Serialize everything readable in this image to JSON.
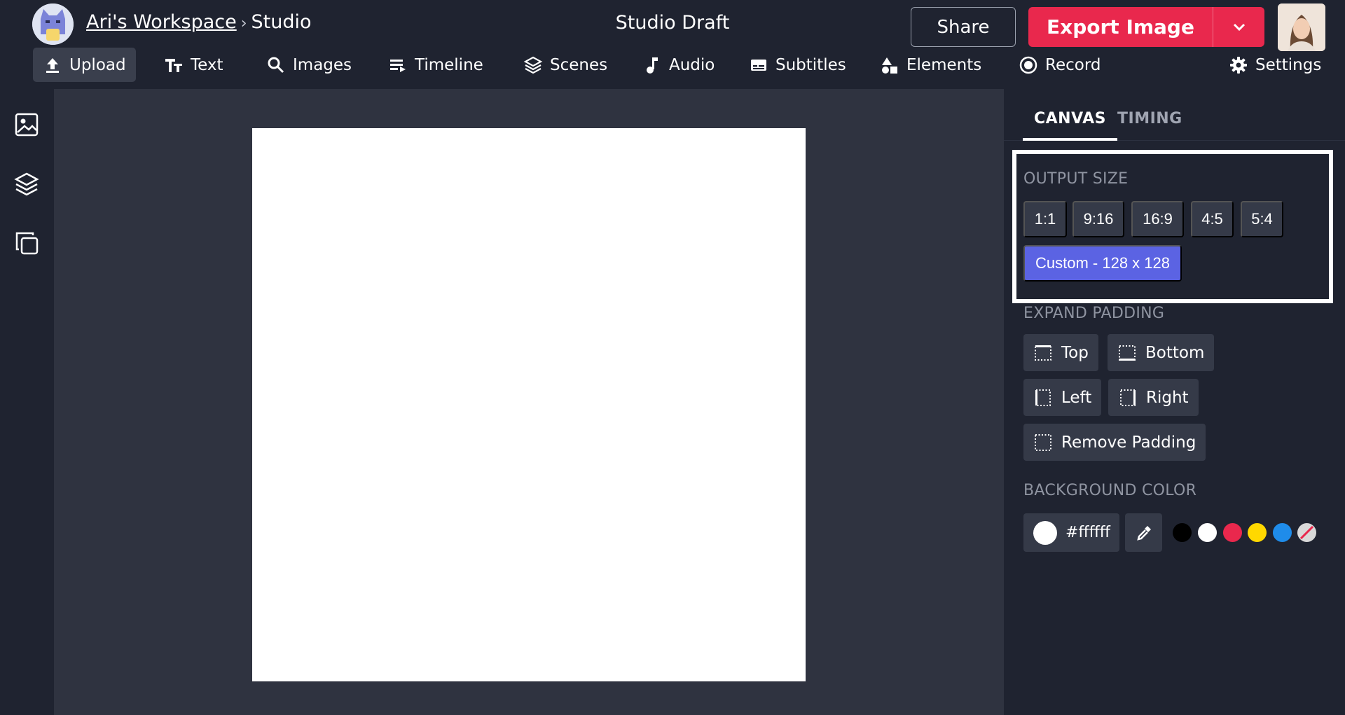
{
  "header": {
    "workspace_link": "Ari's Workspace",
    "separator": "›",
    "section": "Studio",
    "doc_title": "Studio Draft",
    "share_label": "Share",
    "export_label": "Export Image"
  },
  "toolbar": {
    "items": [
      {
        "label": "Upload",
        "icon": "upload-icon",
        "active": true
      },
      {
        "label": "Text",
        "icon": "text-icon"
      },
      {
        "label": "Images",
        "icon": "search-icon"
      },
      {
        "label": "Timeline",
        "icon": "timeline-icon"
      },
      {
        "label": "Scenes",
        "icon": "layers-icon"
      },
      {
        "label": "Audio",
        "icon": "music-note-icon"
      },
      {
        "label": "Subtitles",
        "icon": "subtitles-icon"
      },
      {
        "label": "Elements",
        "icon": "shapes-icon"
      },
      {
        "label": "Record",
        "icon": "record-icon"
      },
      {
        "label": "Settings",
        "icon": "gear-icon"
      }
    ]
  },
  "rail": {
    "items": [
      "image-icon",
      "layers-icon",
      "copy-icon"
    ]
  },
  "panel": {
    "tabs": [
      {
        "label": "CANVAS",
        "active": true
      },
      {
        "label": "TIMING",
        "active": false
      }
    ],
    "output_size": {
      "label": "OUTPUT SIZE",
      "ratios": [
        "1:1",
        "9:16",
        "16:9",
        "4:5",
        "5:4"
      ],
      "custom_label": "Custom - 128 x 128"
    },
    "expand_padding": {
      "label": "EXPAND PADDING",
      "top": "Top",
      "bottom": "Bottom",
      "left": "Left",
      "right": "Right",
      "remove": "Remove Padding"
    },
    "background_color": {
      "label": "BACKGROUND COLOR",
      "value": "#ffffff",
      "swatches": [
        "#000000",
        "#ffffff",
        "#e9284d",
        "#ffd800",
        "#1f8cea",
        "transparent"
      ]
    }
  },
  "colors": {
    "accent": "#e9284d",
    "selected": "#5b63e3",
    "header_bg": "#1f2330",
    "canvas_bg": "#2f3340"
  }
}
